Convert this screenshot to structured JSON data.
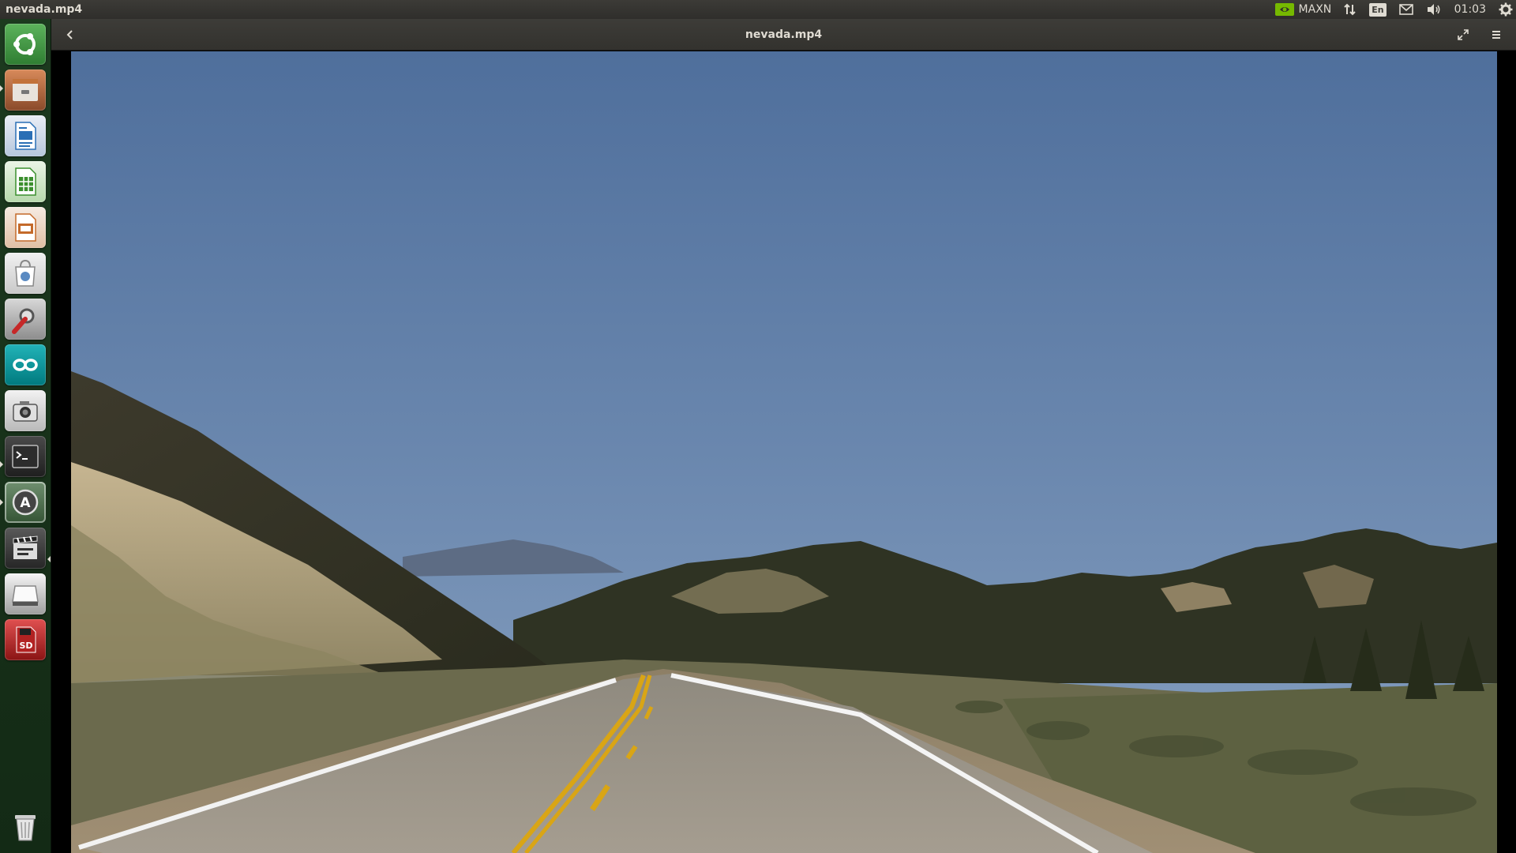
{
  "top_panel": {
    "app_title": "nevada.mp4",
    "power_mode": "MAXN",
    "keyboard_layout": "En",
    "clock": "01:03"
  },
  "player": {
    "title": "nevada.mp4"
  },
  "launcher": {
    "items": [
      {
        "name": "ubuntu-dash-icon",
        "color": "#4e9a06"
      },
      {
        "name": "files-icon",
        "color": "#7a4a2a"
      },
      {
        "name": "libreoffice-writer-icon",
        "color": "#2a6fb5"
      },
      {
        "name": "libreoffice-calc-icon",
        "color": "#3b8f2e"
      },
      {
        "name": "libreoffice-impress-icon",
        "color": "#c46a2a"
      },
      {
        "name": "ubuntu-software-icon",
        "color": "#5a8ac2"
      },
      {
        "name": "system-settings-icon",
        "color": "#6b6b6b"
      },
      {
        "name": "arduino-icon",
        "color": "#00979c"
      },
      {
        "name": "cheese-camera-icon",
        "color": "#9a9a9a"
      },
      {
        "name": "terminal-icon",
        "color": "#2c2c2c"
      },
      {
        "name": "software-updater-icon",
        "color": "#5e5e5e"
      },
      {
        "name": "video-player-icon",
        "color": "#3a3a3a"
      },
      {
        "name": "drive-icon",
        "color": "#bdbdbd"
      },
      {
        "name": "sd-card-icon",
        "color": "#b22222"
      },
      {
        "name": "trash-icon",
        "color": "#8a8a8a"
      }
    ]
  },
  "colors": {
    "sky_top": "#4f6f9c",
    "sky_bottom": "#8aa3c2",
    "nvidia_green": "#76b900"
  }
}
